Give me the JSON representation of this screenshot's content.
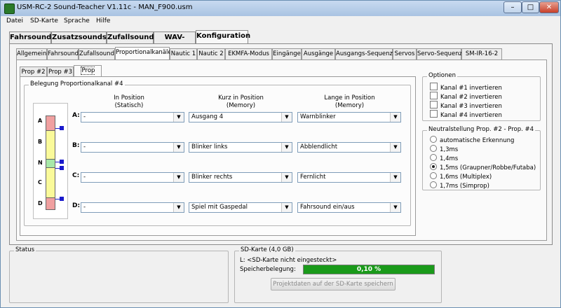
{
  "window": {
    "title": "USM-RC-2 Sound-Teacher V1.11c - MAN_F900.usm"
  },
  "menu": [
    "Datei",
    "SD-Karte",
    "Sprache",
    "Hilfe"
  ],
  "main_tabs": [
    "Fahrsound",
    "Zusatzsounds",
    "Zufallsounds",
    "WAV-Player",
    "Konfiguration"
  ],
  "config_tabs": [
    "Allgemein",
    "Fahrsound",
    "Zufallsound",
    "Proportionalkanäle",
    "Nautic 1",
    "Nautic 2",
    "EKMFA-Modus",
    "Eingänge",
    "Ausgänge",
    "Ausgangs-Sequenz",
    "Servos",
    "Servo-Sequenz",
    "SM-IR-16-2"
  ],
  "prop_tabs": [
    "Prop #2",
    "Prop #3",
    "Prop #4"
  ],
  "assign_group": {
    "legend": "Belegung Proportionalkanal #4",
    "col_heads": [
      {
        "line1": "In Position",
        "line2": "(Statisch)"
      },
      {
        "line1": "Kurz in Position",
        "line2": "(Memory)"
      },
      {
        "line1": "Lange in Position",
        "line2": "(Memory)"
      }
    ],
    "rows": [
      {
        "label": "A:",
        "values": [
          "-",
          "Ausgang 4",
          "Warnblinker"
        ]
      },
      {
        "label": "B:",
        "values": [
          "-",
          "Blinker links",
          "Abblendlicht"
        ]
      },
      {
        "label": "C:",
        "values": [
          "-",
          "Blinker rechts",
          "Fernlicht"
        ]
      },
      {
        "label": "D:",
        "values": [
          "-",
          "Spiel mit Gaspedal",
          "Fahrsound ein/aus"
        ]
      }
    ],
    "diagram_labels": [
      "A",
      "B",
      "N",
      "C",
      "D"
    ],
    "colors": {
      "end_zone": "#f0a0a0",
      "mid_zone": "#fafa9a",
      "neutral": "#a8e8a8",
      "marker": "#1a1acc"
    }
  },
  "options": {
    "legend": "Optionen",
    "checkboxes": [
      "Kanal #1 invertieren",
      "Kanal #2 invertieren",
      "Kanal #3 invertieren",
      "Kanal #4 invertieren"
    ]
  },
  "neutral": {
    "legend": "Neutralstellung Prop. #2 - Prop. #4",
    "options": [
      "automatische Erkennung",
      "1,3ms",
      "1,4ms",
      "1,5ms (Graupner/Robbe/Futaba)",
      "1,6ms (Multiplex)",
      "1,7ms (Simprop)"
    ],
    "selected_index": 3
  },
  "status": {
    "legend": "Status"
  },
  "sd_card": {
    "legend": "SD-Karte (4,0 GB)",
    "drive_line": "L: <SD-Karte nicht eingesteckt>",
    "usage_label": "Speicherbelegung:",
    "usage_value": "0,10 %",
    "usage_fraction": 0.001,
    "save_button": "Projektdaten auf der SD-Karte speichern",
    "bar_color": "#1a9a1a"
  }
}
